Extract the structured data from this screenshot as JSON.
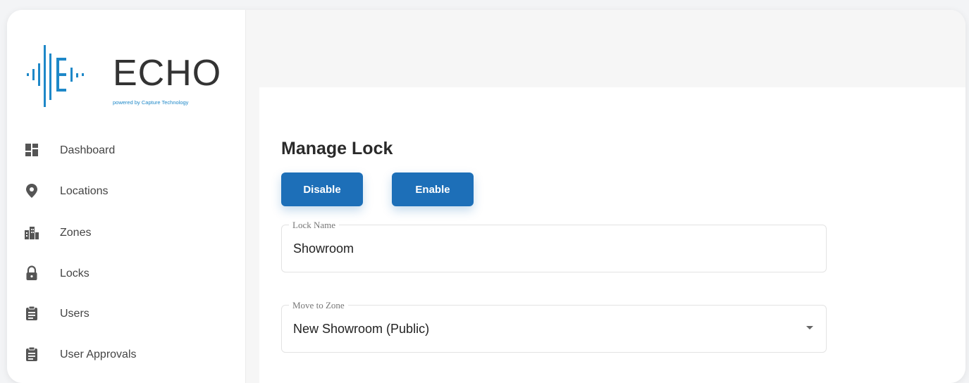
{
  "app": {
    "logo_text": "ECHO",
    "logo_tagline": "powered by Capture Technology",
    "brand_color": "#1e88c8"
  },
  "sidebar": {
    "items": [
      {
        "label": "Dashboard",
        "icon": "dashboard-icon"
      },
      {
        "label": "Locations",
        "icon": "location-pin-icon"
      },
      {
        "label": "Zones",
        "icon": "buildings-icon"
      },
      {
        "label": "Locks",
        "icon": "lock-icon"
      },
      {
        "label": "Users",
        "icon": "clipboard-icon"
      },
      {
        "label": "User Approvals",
        "icon": "clipboard-icon"
      }
    ]
  },
  "main": {
    "title": "Manage Lock",
    "buttons": {
      "disable": "Disable",
      "enable": "Enable"
    },
    "lock_name": {
      "label": "Lock Name",
      "value": "Showroom"
    },
    "zone": {
      "label": "Move to Zone",
      "value": "New Showroom (Public)"
    },
    "button_color": "#1d6fb8"
  }
}
